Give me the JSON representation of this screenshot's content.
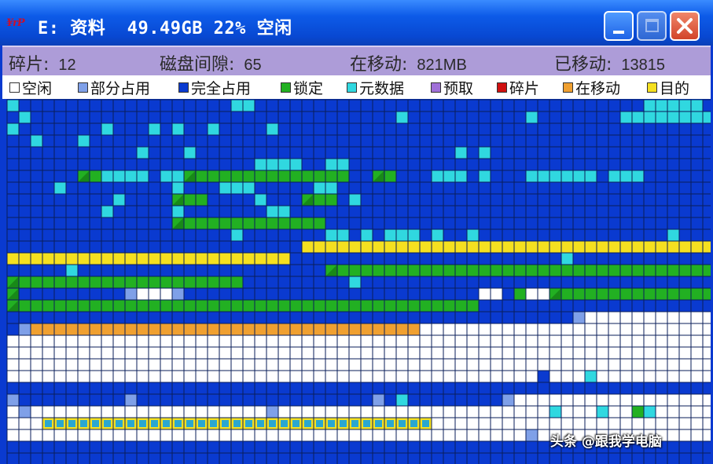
{
  "title_bar": {
    "logo_text": "¥rP",
    "title": "E: 资料  49.49GB 22% 空闲"
  },
  "stats": [
    {
      "label": "碎片:",
      "value": "12"
    },
    {
      "label": "磁盘间隙:",
      "value": "65"
    },
    {
      "label": "在移动:",
      "value": "821MB"
    },
    {
      "label": "已移动:",
      "value": "13815"
    }
  ],
  "legend": [
    {
      "key": "free",
      "label": "空闲",
      "color": "#ffffff"
    },
    {
      "key": "partial",
      "label": "部分占用",
      "color": "#7fa0e8"
    },
    {
      "key": "full",
      "label": "完全占用",
      "color": "#0a3ad0"
    },
    {
      "key": "locked",
      "label": "锁定",
      "color": "#22b022"
    },
    {
      "key": "metadata",
      "label": "元数据",
      "color": "#30d8e0"
    },
    {
      "key": "reserved",
      "label": "预取",
      "color": "#a070d8"
    },
    {
      "key": "fragment",
      "label": "碎片",
      "color": "#d01010"
    },
    {
      "key": "moving",
      "label": "在移动",
      "color": "#f0a030"
    },
    {
      "key": "target",
      "label": "目的",
      "color": "#f5e020"
    }
  ],
  "grid_line_color": "#0a1e5a",
  "watermark": "头条 @跟我学电脑"
}
